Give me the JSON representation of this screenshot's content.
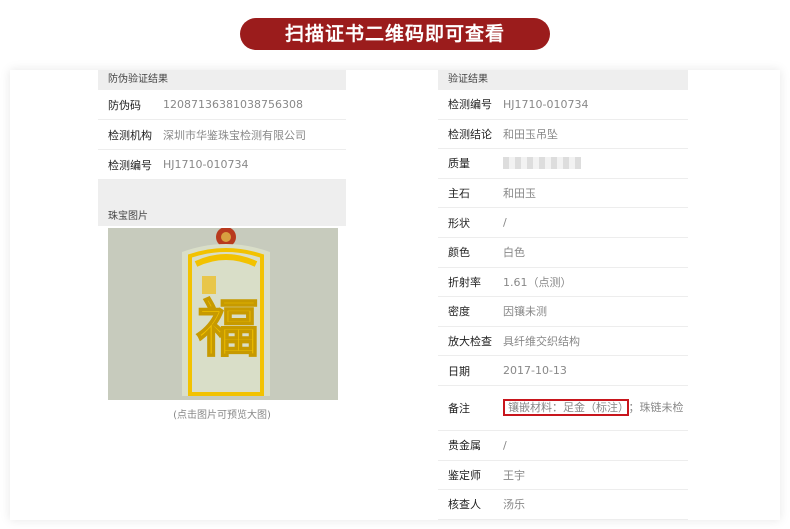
{
  "banner": {
    "text": "扫描证书二维码即可查看"
  },
  "left_section": {
    "header": "防伪验证结果",
    "rows": [
      {
        "label": "防伪码",
        "value": "12087136381038756308"
      },
      {
        "label": "检测机构",
        "value": "深圳市华鉴珠宝检测有限公司"
      },
      {
        "label": "检测编号",
        "value": "HJ1710-010734"
      }
    ],
    "photo_header": "珠宝图片",
    "photo_caption": "(点击图片可预览大图)",
    "photo_char": "福"
  },
  "right_section": {
    "header": "验证结果",
    "rows": [
      {
        "label": "检测编号",
        "value": "HJ1710-010734"
      },
      {
        "label": "检测结论",
        "value": "和田玉吊坠"
      },
      {
        "label": "质量",
        "value": ""
      },
      {
        "label": "主石",
        "value": "和田玉"
      },
      {
        "label": "形状",
        "value": "/"
      },
      {
        "label": "颜色",
        "value": "白色"
      },
      {
        "label": "折射率",
        "value": "1.61（点测）"
      },
      {
        "label": "密度",
        "value": "因镶未测"
      },
      {
        "label": "放大检查",
        "value": "具纤维交织结构"
      },
      {
        "label": "日期",
        "value": "2017-10-13"
      },
      {
        "label": "备注",
        "value_highlight": "镶嵌材料：足金（标注）",
        "value_rest": "；珠链未检"
      },
      {
        "label": "贵金属",
        "value": "/"
      },
      {
        "label": "鉴定师",
        "value": "王宇"
      },
      {
        "label": "核查人",
        "value": "汤乐"
      }
    ]
  },
  "colors": {
    "banner": "#9b1c1c",
    "highlight_border": "#c8161d",
    "jade": "#d9dec8",
    "gold": "#f2c200"
  }
}
